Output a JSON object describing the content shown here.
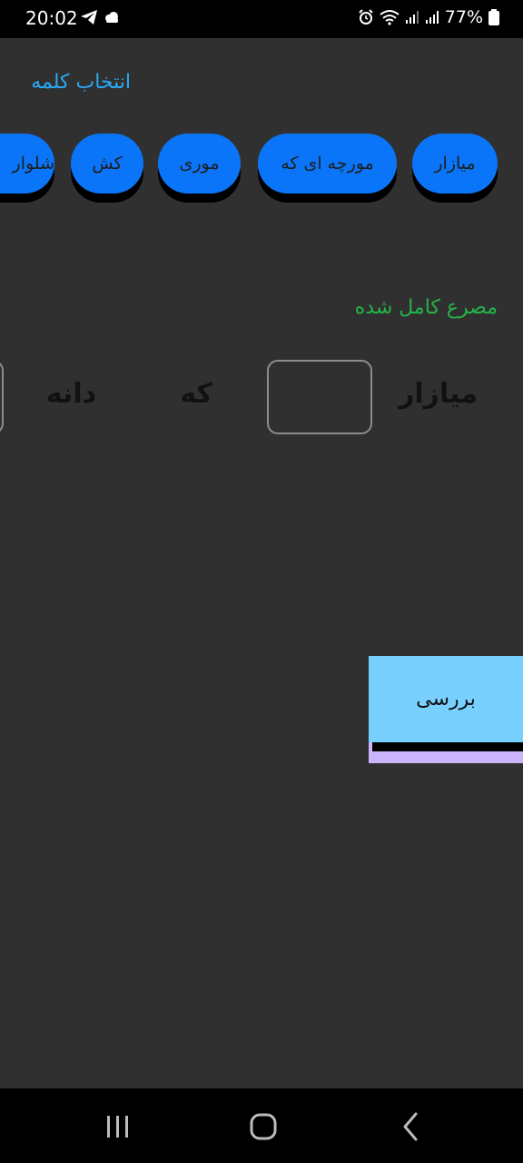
{
  "status_bar": {
    "time": "20:02",
    "battery_percent": "77%",
    "icons": [
      "telegram-icon",
      "cloud-icon",
      "alarm-icon",
      "wifi-icon",
      "signal-icon",
      "signal-icon",
      "battery-icon"
    ]
  },
  "word_picker": {
    "title": "انتخاب کلمه",
    "chips": [
      "میازار",
      "مورچه ای که",
      "موری",
      "کش",
      "شلوار"
    ]
  },
  "verse": {
    "title": "مصرع کامل شده",
    "words": [
      "میازار",
      "که",
      "دانه"
    ]
  },
  "actions": {
    "check_label": "بررسی"
  },
  "nav_bar": {
    "icons": [
      "recent-apps-icon",
      "home-icon",
      "back-icon"
    ]
  },
  "colors": {
    "background": "#303030",
    "chip_blue": "#0a75f8",
    "title_blue": "#29a9f5",
    "verse_green": "#24b34a",
    "check_button": "#78d0ff",
    "check_shadow": "#cab4fb"
  }
}
